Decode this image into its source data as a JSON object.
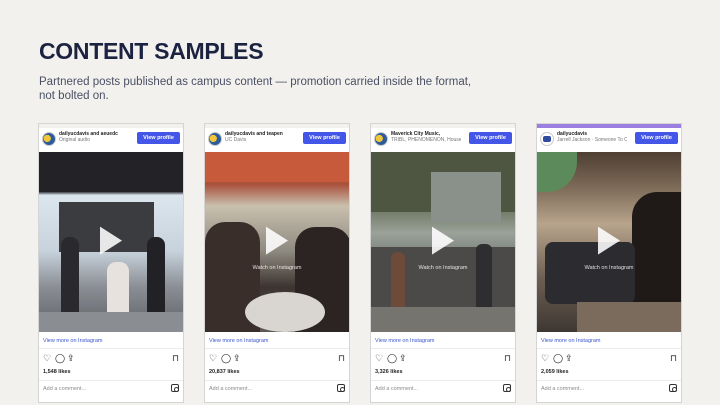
{
  "page": {
    "title": "CONTENT SAMPLES",
    "subtitle": "Partnered posts published as campus content — promotion carried inside the format, not bolted on."
  },
  "cards": [
    {
      "account": "dailyucdavis and aeuedc",
      "sub": "Original audio",
      "view_profile": "View profile",
      "watch": "",
      "view_more": "View more on Instagram",
      "likes": "1,548 likes",
      "add_comment": "Add a comment...",
      "top_color": "#f2f1ee"
    },
    {
      "account": "dailyucdavis and teapen",
      "sub": "UC Davis",
      "view_profile": "View profile",
      "watch": "Watch on Instagram",
      "view_more": "View more on Instagram",
      "likes": "20,837 likes",
      "add_comment": "Add a comment...",
      "top_color": "#f2f1ee"
    },
    {
      "account": "Maverick City Music,",
      "sub": "TRIBL, PHENOMENON, Housefires - I Thank God (feat. Dante Bowe, Aaron Moses & Chandler Moore)",
      "view_profile": "View profile",
      "watch": "Watch on Instagram",
      "view_more": "View more on Instagram",
      "likes": "3,326 likes",
      "add_comment": "Add a comment...",
      "top_color": "#f2f1ee"
    },
    {
      "account": "dailyucdavis",
      "sub": "Jarrell Jackson · Someone To Call My Lover",
      "view_profile": "View profile",
      "watch": "Watch on Instagram",
      "view_more": "View more on Instagram",
      "likes": "2,059 likes",
      "add_comment": "Add a comment...",
      "top_color": "#9a7fe0"
    }
  ],
  "icons": {
    "heart": "heart-icon",
    "comment": "comment-icon",
    "share": "share-icon",
    "bookmark": "bookmark-icon",
    "instagram": "instagram-icon",
    "play": "play-icon"
  },
  "colors": {
    "accent_button": "#4356e8",
    "link": "#3a55c9",
    "title": "#1c2340"
  }
}
